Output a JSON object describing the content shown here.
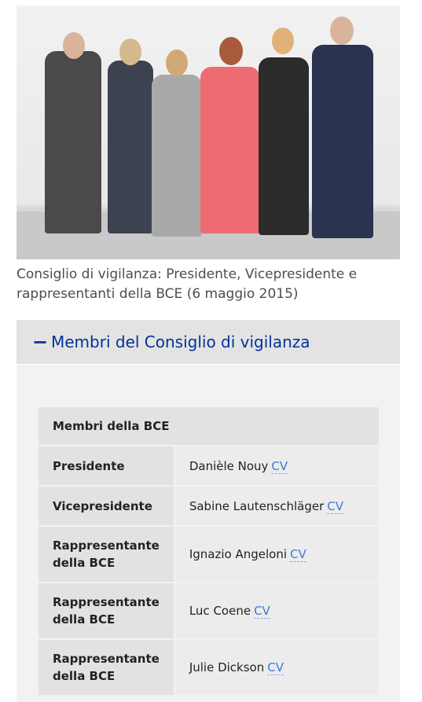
{
  "photo": {
    "alt": "Consiglio di vigilanza group photo"
  },
  "caption": "Consiglio di vigilanza: Presidente, Vicepresidente e rappresentanti della BCE (6 maggio 2015)",
  "accordion": {
    "toggle_symbol": "−",
    "title": "Membri del Consiglio di vigilanza"
  },
  "table": {
    "header": "Membri della BCE",
    "cv_label": "CV",
    "rows": [
      {
        "role": "Presidente",
        "name": "Danièle Nouy"
      },
      {
        "role": "Vicepresidente",
        "name": "Sabine Lautenschläger"
      },
      {
        "role": "Rappresentante della BCE",
        "name": "Ignazio Angeloni"
      },
      {
        "role": "Rappresentante della BCE",
        "name": "Luc Coene"
      },
      {
        "role": "Rappresentante della BCE",
        "name": "Julie Dickson"
      }
    ]
  }
}
